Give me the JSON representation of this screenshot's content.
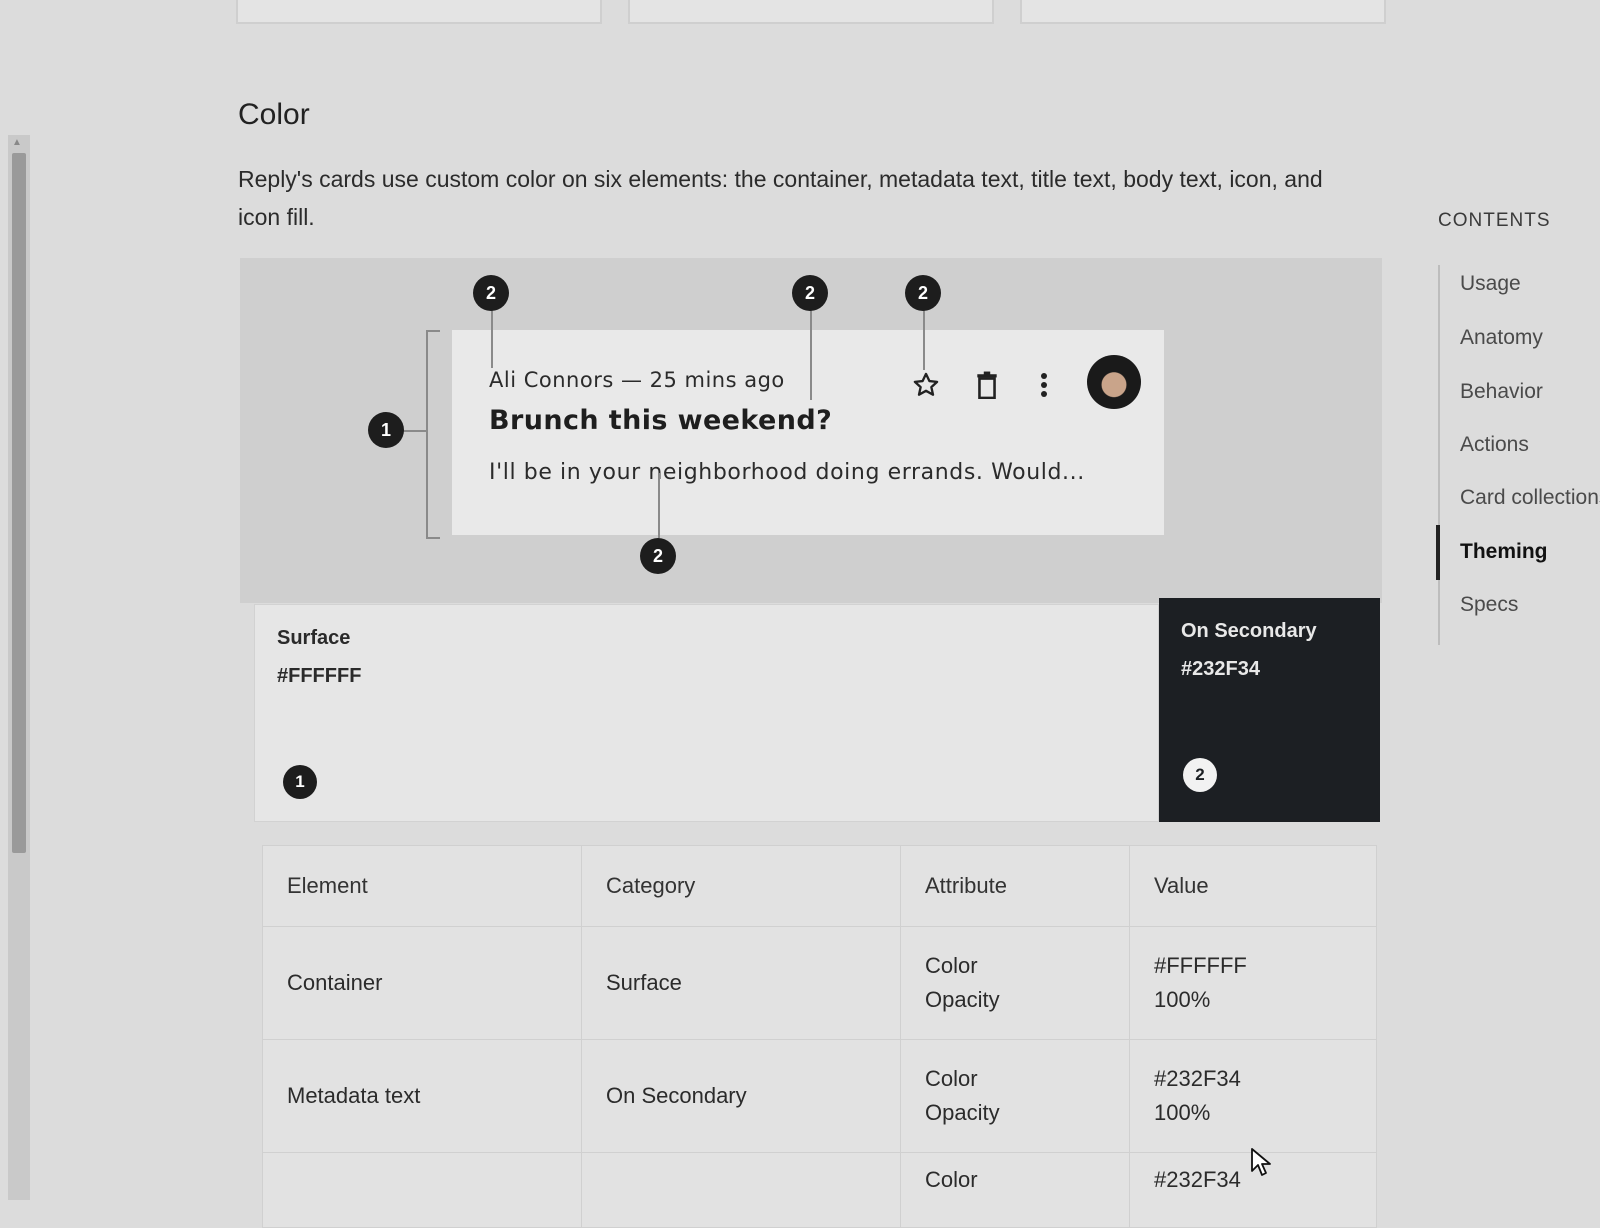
{
  "section": {
    "title": "Color",
    "description": "Reply's cards use custom color on six elements: the container, metadata text, title text, body text, icon, and icon fill."
  },
  "demo_card": {
    "metadata": "Ali Connors — 25 mins ago",
    "title": "Brunch this weekend?",
    "body": "I'll be in your neighborhood doing errands. Would...",
    "icons": [
      "star-outline-icon",
      "trash-icon",
      "more-vert-icon"
    ],
    "markers": {
      "container": "1",
      "metadata": "2",
      "body": "2",
      "star": "2",
      "trash_line": "2"
    }
  },
  "swatches": [
    {
      "name": "Surface",
      "hex": "#FFFFFF",
      "marker": "1"
    },
    {
      "name": "On Secondary",
      "hex": "#232F34",
      "marker": "2"
    }
  ],
  "table": {
    "headers": [
      "Element",
      "Category",
      "Attribute",
      "Value"
    ],
    "rows": [
      {
        "element": "Container",
        "category": "Surface",
        "attr1": "Color",
        "attr2": "Opacity",
        "val1": "#FFFFFF",
        "val2": "100%"
      },
      {
        "element": "Metadata text",
        "category": "On Secondary",
        "attr1": "Color",
        "attr2": "Opacity",
        "val1": "#232F34",
        "val2": "100%"
      },
      {
        "attr1": "Color",
        "val1": "#232F34"
      }
    ]
  },
  "toc": {
    "heading": "CONTENTS",
    "items": [
      "Usage",
      "Anatomy",
      "Behavior",
      "Actions",
      "Card collections",
      "Theming",
      "Specs"
    ],
    "active": "Theming"
  },
  "colors": {
    "on_secondary": "#232F34",
    "surface": "#FFFFFF"
  }
}
